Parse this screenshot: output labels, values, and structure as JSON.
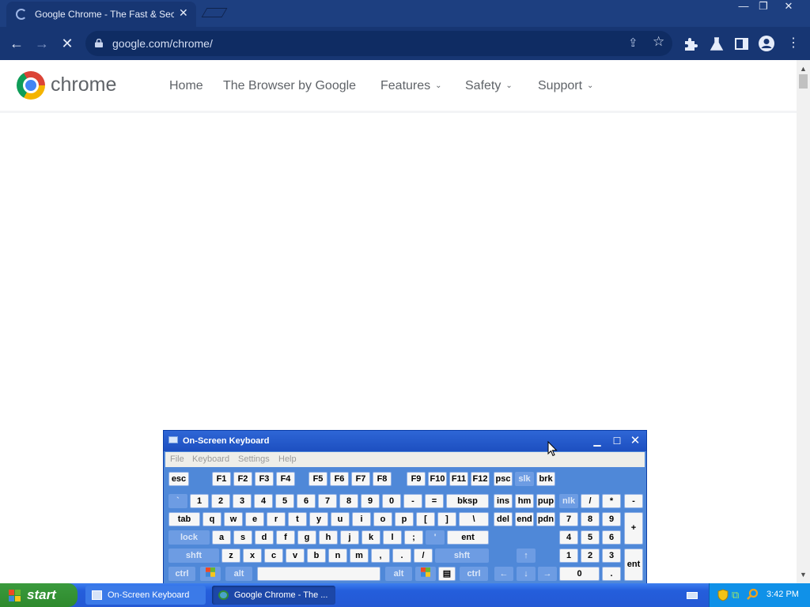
{
  "browser": {
    "tab_title": "Google Chrome - The Fast & Secure",
    "tab_close": "✕",
    "url": "google.com/chrome/",
    "window_controls": [
      "—",
      "❐",
      "✕"
    ]
  },
  "site": {
    "brand": "chrome",
    "nav": [
      "Home",
      "The Browser by Google",
      "Features",
      "Safety",
      "Support"
    ]
  },
  "osk": {
    "title": "On-Screen Keyboard",
    "menu": [
      "File",
      "Keyboard",
      "Settings",
      "Help"
    ],
    "rows": {
      "fn": [
        "esc",
        "F1",
        "F2",
        "F3",
        "F4",
        "F5",
        "F6",
        "F7",
        "F8",
        "F9",
        "F10",
        "F11",
        "F12",
        "psc",
        "slk",
        "brk"
      ],
      "num": [
        "`",
        "1",
        "2",
        "3",
        "4",
        "5",
        "6",
        "7",
        "8",
        "9",
        "0",
        "-",
        "=",
        "bksp",
        "ins",
        "hm",
        "pup",
        "nlk",
        "/",
        "*",
        "-"
      ],
      "top": [
        "tab",
        "q",
        "w",
        "e",
        "r",
        "t",
        "y",
        "u",
        "i",
        "o",
        "p",
        "[",
        "]",
        "\\",
        "del",
        "end",
        "pdn",
        "7",
        "8",
        "9",
        "+"
      ],
      "home": [
        "lock",
        "a",
        "s",
        "d",
        "f",
        "g",
        "h",
        "j",
        "k",
        "l",
        ";",
        "'",
        "ent",
        "4",
        "5",
        "6"
      ],
      "shift": [
        "shft",
        "z",
        "x",
        "c",
        "v",
        "b",
        "n",
        "m",
        ",",
        ".",
        "/",
        "shft",
        "↑",
        "1",
        "2",
        "3",
        "ent"
      ],
      "bottom": [
        "ctrl",
        "alt",
        "alt",
        "ctrl",
        "←",
        "↓",
        "→",
        "0",
        "."
      ]
    }
  },
  "taskbar": {
    "start": "start",
    "tasks": [
      "On-Screen Keyboard",
      "Google Chrome - The ..."
    ],
    "clock": "3:42 PM"
  }
}
